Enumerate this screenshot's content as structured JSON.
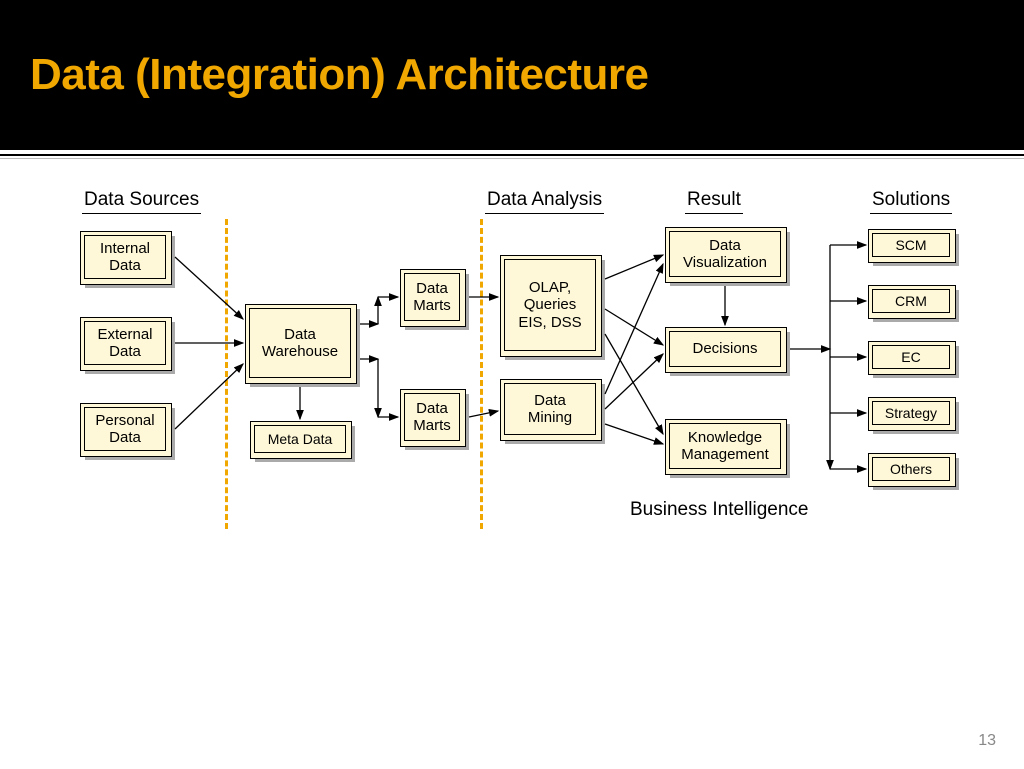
{
  "slide": {
    "title": "Data (Integration) Architecture",
    "page_number": "13",
    "footer_label": "Business Intelligence"
  },
  "headers": {
    "data_sources": "Data Sources",
    "data_analysis": "Data Analysis",
    "result": "Result",
    "solutions": "Solutions"
  },
  "boxes": {
    "internal": "Internal\nData",
    "external": "External\nData",
    "personal": "Personal\nData",
    "warehouse": "Data\nWarehouse",
    "metadata": "Meta Data",
    "mart1": "Data\nMarts",
    "mart2": "Data\nMarts",
    "olap": "OLAP,\nQueries\nEIS, DSS",
    "mining": "Data\nMining",
    "dataviz": "Data\nVisualization",
    "decisions": "Decisions",
    "knowledge": "Knowledge\nManagement",
    "scm": "SCM",
    "crm": "CRM",
    "ec": "EC",
    "strategy": "Strategy",
    "others": "Others"
  }
}
